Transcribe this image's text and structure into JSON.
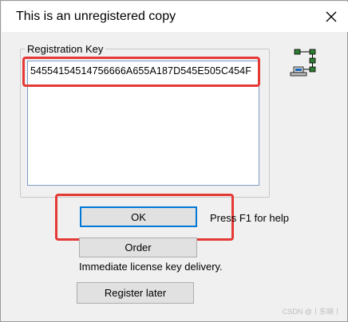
{
  "dialog": {
    "title": "This is an unregistered copy",
    "close_icon": "close-icon"
  },
  "registration": {
    "group_label": "Registration Key",
    "key_value": "54554154514756666A655A187D545E505C454F"
  },
  "icons": {
    "network": "network-icon"
  },
  "buttons": {
    "ok": "OK",
    "order": "Order",
    "register_later": "Register later"
  },
  "help_text": "Press F1 for help",
  "license_text": "Immediate license key delivery.",
  "watermark": "CSDN @丨东晓丨",
  "colors": {
    "annotation": "#e53935",
    "focus_border": "#0078d7"
  }
}
